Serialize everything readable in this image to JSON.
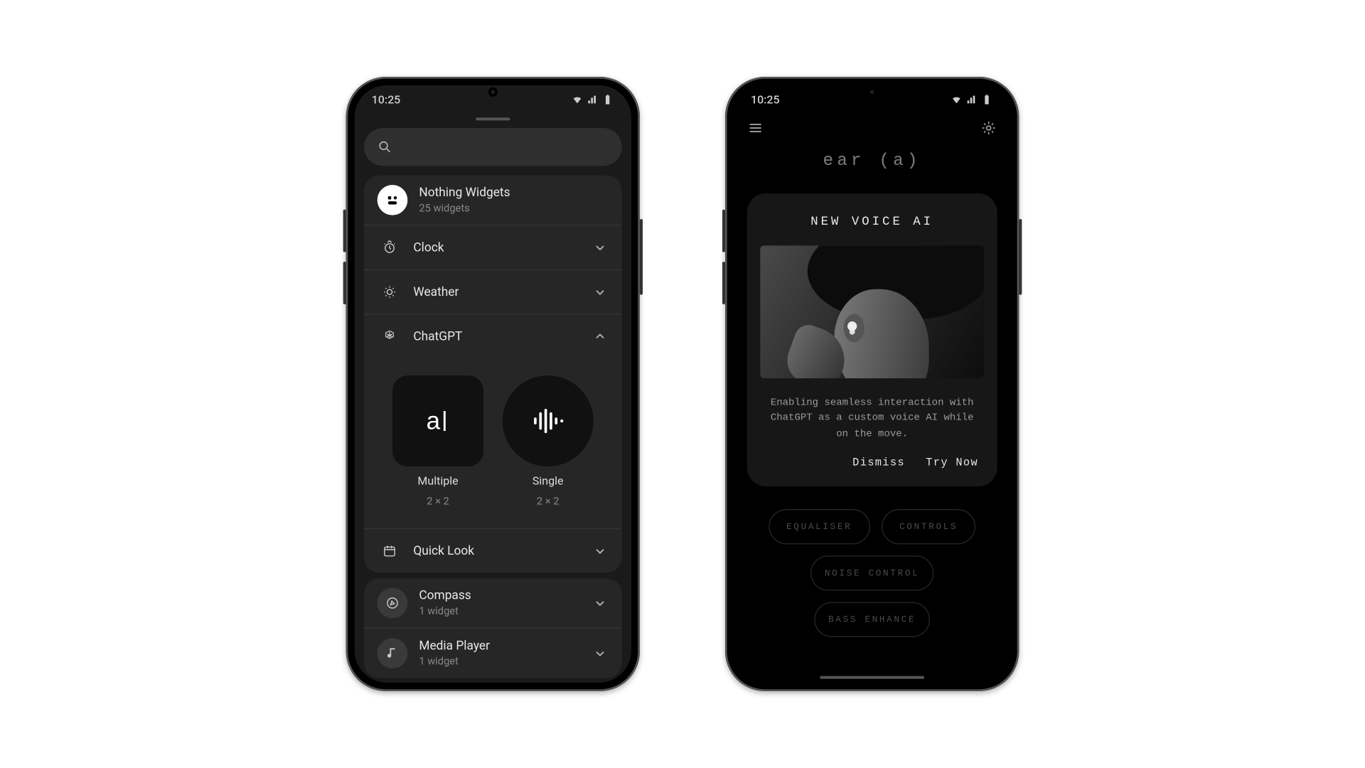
{
  "status": {
    "time": "10:25"
  },
  "phone1": {
    "header": {
      "title": "Nothing Widgets",
      "subtitle": "25 widgets"
    },
    "rows": {
      "clock": "Clock",
      "weather": "Weather",
      "chatgpt": "ChatGPT",
      "quicklook": "Quick Look"
    },
    "widgets": {
      "multiple": {
        "label": "Multiple",
        "size": "2 × 2"
      },
      "single": {
        "label": "Single",
        "size": "2 × 2"
      }
    },
    "compass": {
      "title": "Compass",
      "subtitle": "1 widget"
    },
    "media": {
      "title": "Media Player",
      "subtitle": "1 widget"
    }
  },
  "phone2": {
    "product": "ear (a)",
    "modal": {
      "title": "NEW VOICE AI",
      "desc": "Enabling seamless interaction with ChatGPT as a custom voice AI while on the move.",
      "dismiss": "Dismiss",
      "try": "Try Now"
    },
    "chips": {
      "equaliser": "EQUALISER",
      "controls": "CONTROLS",
      "noise": "NOISE CONTROL",
      "bass": "BASS ENHANCE"
    }
  }
}
